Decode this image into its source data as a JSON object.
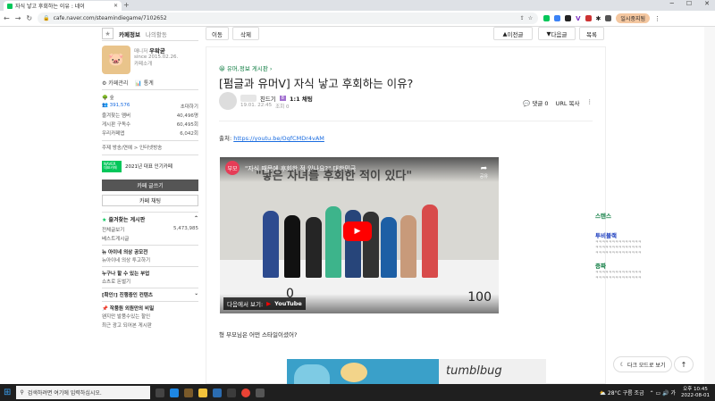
{
  "browser": {
    "tab_title": "자식 낳고 후회하는 이유 : 네이",
    "url": "cafe.naver.com/steamindiegame/7102652",
    "profile_label": "일시중지됨"
  },
  "cafe": {
    "tab_info": "카페정보",
    "tab_activity": "나의활동",
    "manager_label": "매니저",
    "manager_name": "우왁굳",
    "since": "since 2015.02.26.",
    "intro": "카페소개",
    "manage": "카페관리",
    "stats": "통계",
    "rank": "숲",
    "members": "391,576",
    "invite": "초대하기",
    "fav_label": "즐겨찾는 멤버",
    "fav_count": "40,496명",
    "sub_label": "게시판 구독수",
    "sub_count": "60,495회",
    "rank_label": "우리카페앱",
    "rank_count": "6,042회",
    "theme": "주제 방송/연예 > 인터넷방송",
    "award_badge": "NAVER 대표카페",
    "award_text": "2021년 대표 인기카페",
    "write_btn": "카페 글쓰기",
    "chat_btn": "카페 채팅",
    "favboards_title": "즐겨찾는 게시판",
    "all_posts": "전체글보기",
    "all_posts_count": "5,473,985",
    "best_posts": "베스트게시글",
    "contest_title": "뉴 아이네 의상 공모전",
    "contest_item": "뉴아이네 의상 투고하기",
    "buy_title": "누구나 할 수 있는 부업",
    "buy_item": "쇼츠로 돈벌기",
    "notice_title": "[확인!] 진행중인 컨텐츠",
    "secret_title": "작품원 외원만의 비밀",
    "secret_item1": "왠지만 발품수있는 할인",
    "secret_item2": "최근 광고 되어본 게시판"
  },
  "toolbar": {
    "move": "이동",
    "delete": "삭제",
    "prev": "이전글",
    "next": "다음글",
    "list": "목록"
  },
  "article": {
    "board": "유머,정보 게시판",
    "title": "[펌글과 유머ᐯ] 자식 낳고 후회하는 이유?",
    "author_suffix": "친드기",
    "chat": "1:1 채팅",
    "date": "19.01. 22:45",
    "views": "조회 0",
    "comments": "댓글 0",
    "url_copy": "URL 복사",
    "source_label": "출처:",
    "source_link": "https://youtu.be/OqfCMDr4vAM",
    "video_title": "\"자식 때문에 후회한 적 있나요?\" 대한민국",
    "video_caption": "\"낳은 자녀를 후회한 적이 있다\"",
    "share": "공유",
    "watch_on": "다음에서 보기:",
    "youtube": "YouTube",
    "num_0": "0",
    "num_100": "100",
    "question": "형 부모님은 어떤 스타일이셨어?",
    "banner_text": "tumblbug"
  },
  "side_chat": {
    "item1": "스텐스",
    "item2": "투비블랙",
    "item3": "증짜",
    "filler": "ㅋㅋㅋㅋㅋㅋㅋㅋㅋㅋㅋㅋㅋㅋ"
  },
  "darkmode": "다크 모드로 보기",
  "taskbar": {
    "search_placeholder": "검색하려면 여기에 입력하십시오.",
    "weather": "28°C 구름 조금",
    "time": "오후 10:45",
    "date": "2022-08-01"
  },
  "colors": {
    "naver_green": "#03c75a",
    "title_blue": "#1a3cbe",
    "youtube_red": "#ff0000"
  }
}
